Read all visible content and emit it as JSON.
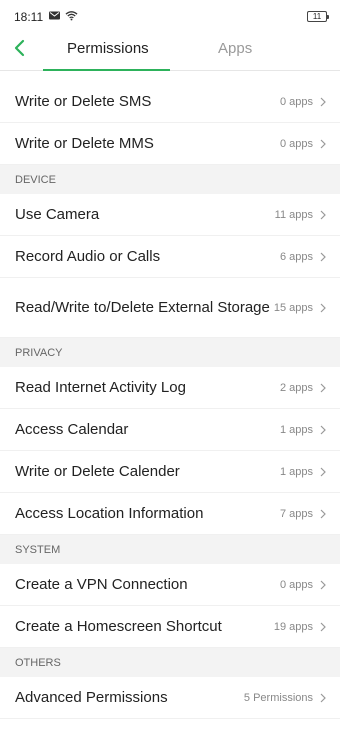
{
  "status_bar": {
    "time": "18:11",
    "battery": "11"
  },
  "tabs": [
    {
      "label": "Permissions",
      "active": true
    },
    {
      "label": "Apps",
      "active": false
    }
  ],
  "accent_color": "#2db25b",
  "rows_top": [
    {
      "label": "Write or Delete SMS",
      "count": "0 apps"
    },
    {
      "label": "Write or Delete MMS",
      "count": "0 apps"
    }
  ],
  "sections": [
    {
      "title": "DEVICE",
      "items": [
        {
          "label": "Use Camera",
          "count": "11 apps"
        },
        {
          "label": "Record Audio or Calls",
          "count": "6 apps"
        },
        {
          "label": "Read/Write to/Delete External Storage",
          "count": "15 apps"
        }
      ]
    },
    {
      "title": "PRIVACY",
      "items": [
        {
          "label": "Read Internet Activity Log",
          "count": "2 apps"
        },
        {
          "label": "Access Calendar",
          "count": "1 apps"
        },
        {
          "label": "Write or Delete Calender",
          "count": "1 apps"
        },
        {
          "label": "Access Location Information",
          "count": "7 apps"
        }
      ]
    },
    {
      "title": "SYSTEM",
      "items": [
        {
          "label": "Create a VPN Connection",
          "count": "0 apps"
        },
        {
          "label": "Create a Homescreen Shortcut",
          "count": "19 apps"
        }
      ]
    },
    {
      "title": "OTHERS",
      "items": [
        {
          "label": "Advanced Permissions",
          "count": "5 Permissions"
        }
      ]
    }
  ]
}
